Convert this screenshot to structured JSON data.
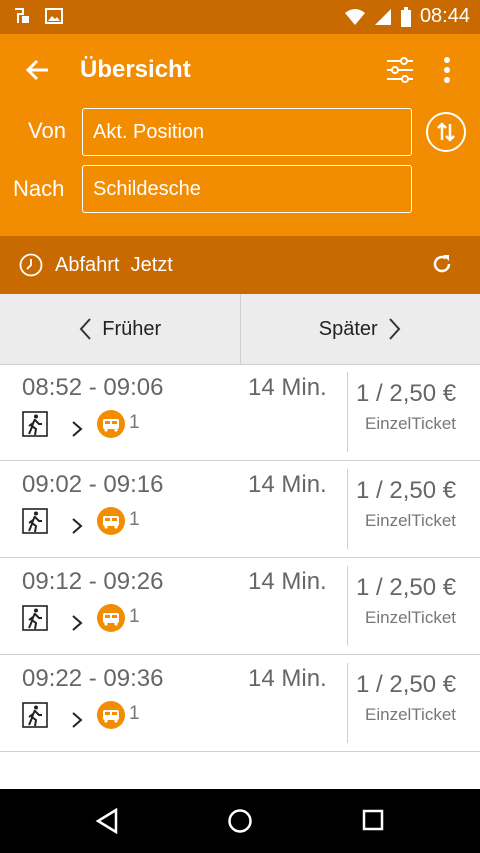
{
  "status_bar": {
    "time": "08:44",
    "bg": "#c86a00"
  },
  "header": {
    "title": "Übersicht",
    "back_icon": "arrow-left-icon",
    "filter_icon": "sliders-icon",
    "menu_icon": "more-vert-icon",
    "color": "#f28c00"
  },
  "route": {
    "from_label": "Von",
    "from_value": "Akt. Position",
    "to_label": "Nach",
    "to_value": "Schildesche"
  },
  "departure": {
    "mode_label": "Abfahrt",
    "time_value": "Jetzt"
  },
  "pager": {
    "earlier": "Früher",
    "later": "Später"
  },
  "connections": [
    {
      "times": "08:52 - 09:06",
      "duration": "14 Min.",
      "price": "1 / 2,50 €",
      "ticket": "EinzelTicket",
      "line": "1"
    },
    {
      "times": "09:02 - 09:16",
      "duration": "14 Min.",
      "price": "1 / 2,50 €",
      "ticket": "EinzelTicket",
      "line": "1"
    },
    {
      "times": "09:12 - 09:26",
      "duration": "14 Min.",
      "price": "1 / 2,50 €",
      "ticket": "EinzelTicket",
      "line": "1"
    },
    {
      "times": "09:22 - 09:36",
      "duration": "14 Min.",
      "price": "1 / 2,50 €",
      "ticket": "EinzelTicket",
      "line": "1"
    }
  ]
}
